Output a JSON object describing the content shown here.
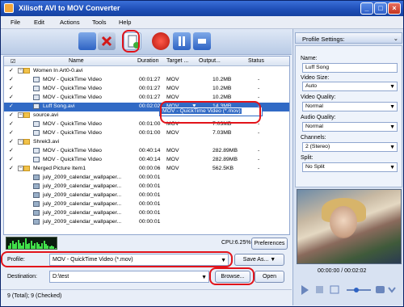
{
  "window": {
    "title": "Xilisoft AVI to MOV Converter"
  },
  "menu": [
    "File",
    "Edit",
    "Actions",
    "Tools",
    "Help"
  ],
  "columns": {
    "name": "Name",
    "duration": "Duration",
    "target": "Target ...",
    "output": "Output...",
    "status": "Status"
  },
  "rows": [
    {
      "type": "folder",
      "name": "Women In Art0-0.avi",
      "duration": "",
      "target": "",
      "output": "",
      "status": "",
      "checked": true
    },
    {
      "type": "file",
      "name": "MOV - QuickTime Video",
      "duration": "00:01:27",
      "target": "MOV",
      "output": "10.2MB",
      "status": "-",
      "checked": true
    },
    {
      "type": "file",
      "name": "MOV - QuickTime Video",
      "duration": "00:01:27",
      "target": "MOV",
      "output": "10.2MB",
      "status": "-",
      "checked": true
    },
    {
      "type": "file",
      "name": "MOV - QuickTime Video",
      "duration": "00:01:27",
      "target": "MOV",
      "output": "10.2MB",
      "status": "-",
      "checked": true
    },
    {
      "type": "file",
      "name": "Luff Song.avi",
      "duration": "00:02:02",
      "target": "MOV",
      "output": "14.3MB",
      "status": "-",
      "checked": true,
      "selected": true
    },
    {
      "type": "folder",
      "name": "source.avi",
      "duration": "",
      "target": "",
      "output": "",
      "status": "",
      "checked": true
    },
    {
      "type": "file",
      "name": "MOV - QuickTime Video",
      "duration": "00:01:00",
      "target": "MOV",
      "output": "7.03MB",
      "status": "-",
      "checked": true
    },
    {
      "type": "file",
      "name": "MOV - QuickTime Video",
      "duration": "00:01:00",
      "target": "MOV",
      "output": "7.03MB",
      "status": "-",
      "checked": true
    },
    {
      "type": "folder",
      "name": "Shrek3.avi",
      "duration": "",
      "target": "",
      "output": "",
      "status": "",
      "checked": true
    },
    {
      "type": "file",
      "name": "MOV - QuickTime Video",
      "duration": "00:40:14",
      "target": "MOV",
      "output": "282.89MB",
      "status": "-",
      "checked": true
    },
    {
      "type": "file",
      "name": "MOV - QuickTime Video",
      "duration": "00:40:14",
      "target": "MOV",
      "output": "282.89MB",
      "status": "-",
      "checked": true
    },
    {
      "type": "folder",
      "name": "Merged Picture Item1",
      "duration": "00:00:06",
      "target": "MOV",
      "output": "562.5KB",
      "status": "-",
      "checked": true
    },
    {
      "type": "image",
      "name": "july_2009_calendar_wallpaper...",
      "duration": "00:00:01",
      "target": "",
      "output": "",
      "status": "",
      "checked": false
    },
    {
      "type": "image",
      "name": "july_2009_calendar_wallpaper...",
      "duration": "00:00:01",
      "target": "",
      "output": "",
      "status": "",
      "checked": false
    },
    {
      "type": "image",
      "name": "july_2009_calendar_wallpaper...",
      "duration": "00:00:01",
      "target": "",
      "output": "",
      "status": "",
      "checked": false
    },
    {
      "type": "image",
      "name": "july_2009_calendar_wallpaper...",
      "duration": "00:00:01",
      "target": "",
      "output": "",
      "status": "",
      "checked": false
    },
    {
      "type": "image",
      "name": "july_2009_calendar_wallpaper...",
      "duration": "00:00:01",
      "target": "",
      "output": "",
      "status": "",
      "checked": false
    },
    {
      "type": "image",
      "name": "july_2009_calendar_wallpaper...",
      "duration": "00:00:01",
      "target": "",
      "output": "",
      "status": "",
      "checked": false
    }
  ],
  "target_dropdown": {
    "value": "MOV",
    "option": "MOV - QuickTime Video (*.mov)"
  },
  "cpu": "CPU:6.25%",
  "preferences_label": "Preferences",
  "profile": {
    "label": "Profile:",
    "value": "MOV - QuickTime Video (*.mov)",
    "save_as": "Save As..."
  },
  "destination": {
    "label": "Destination:",
    "value": "D:\\test",
    "browse": "Browse...",
    "open": "Open"
  },
  "status_text": "9 (Total); 9 (Checked)",
  "settings": {
    "header": "Profile Settings:",
    "name_label": "Name:",
    "name_value": "Luff Song",
    "video_size_label": "Video Size:",
    "video_size_value": "Auto",
    "video_quality_label": "Video Quality:",
    "video_quality_value": "Normal",
    "audio_quality_label": "Audio Quality:",
    "audio_quality_value": "Normal",
    "channels_label": "Channels:",
    "channels_value": "2 (Stereo)",
    "split_label": "Split:",
    "split_value": "No Split"
  },
  "player": {
    "timecode": "00:00:00 / 00:02:02"
  },
  "colors": {
    "selection": "#316ac5",
    "highlight_ring": "#e2131a"
  },
  "visualizer_levels": [
    0.3,
    0.5,
    0.7,
    0.4,
    0.6,
    0.8,
    0.5,
    0.3,
    0.6,
    0.9,
    0.4,
    0.5,
    0.7,
    0.3,
    0.5,
    0.6,
    0.4,
    0.2,
    0.5,
    0.7,
    0.4,
    0.3,
    0.2,
    0.3,
    0.2,
    0.1
  ]
}
